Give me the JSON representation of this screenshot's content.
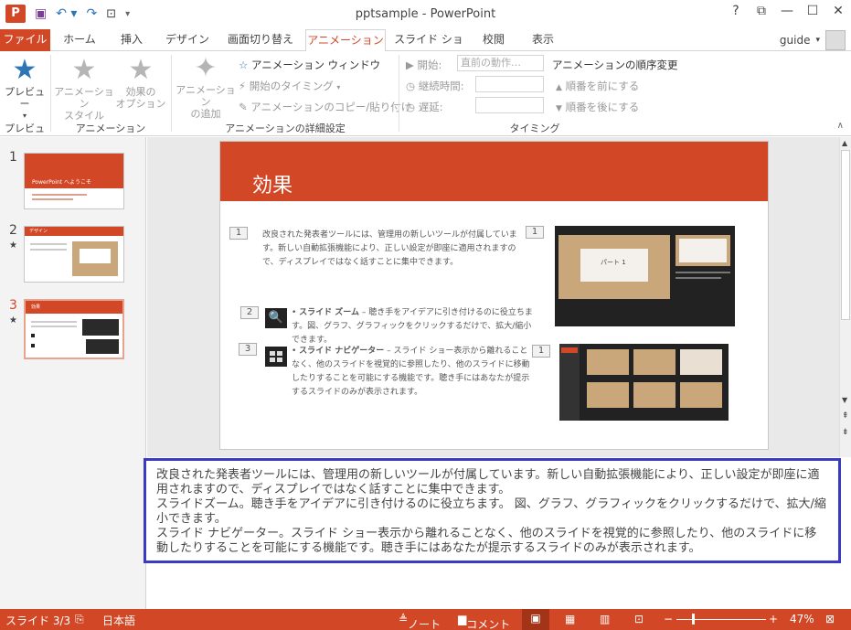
{
  "window": {
    "title": "pptsample - PowerPoint",
    "buttons": [
      "?",
      "⧉",
      "—",
      "☐",
      "✕"
    ]
  },
  "tabs": [
    "ファイル",
    "ホーム",
    "挿入",
    "デザイン",
    "画面切り替え",
    "アニメーション",
    "スライド ショー",
    "校閲",
    "表示"
  ],
  "user": {
    "name": "guide"
  },
  "ribbon": {
    "preview": {
      "label": "プレビュー",
      "group": "プレビュー"
    },
    "animation_style": {
      "label1": "アニメーション",
      "label2": "スタイル"
    },
    "effect_options": {
      "label1": "効果の",
      "label2": "オプション"
    },
    "animation_group": "アニメーション",
    "add_animation": {
      "label1": "アニメーション",
      "label2": "の追加"
    },
    "animation_pane": "アニメーション ウィンドウ",
    "trigger": "開始のタイミング",
    "painter": "アニメーションのコピー/貼り付け",
    "advanced_group": "アニメーションの詳細設定",
    "start_label": "開始:",
    "start_value": "直前の動作…",
    "duration_label": "継続時間:",
    "delay_label": "遅延:",
    "timing_group": "タイミング",
    "reorder_title": "アニメーションの順序変更",
    "move_earlier": "順番を前にする",
    "move_later": "順番を後にする"
  },
  "thumbnails": [
    {
      "num": "1",
      "star": "",
      "title": "PowerPoint へようこそ"
    },
    {
      "num": "2",
      "star": "★",
      "title": "デザイン"
    },
    {
      "num": "3",
      "star": "★",
      "title": "効果"
    }
  ],
  "slide": {
    "title": "効果",
    "para1": "改良された発表者ツールには、管理用の新しいツールが付属しています。新しい自動拡張機能により、正しい設定が即座に適用されますので、ディスプレイではなく話すことに集中できます。",
    "b1_bold": "スライド ズーム",
    "b1_text": " – 聴き手をアイデアに引き付けるのに役立ちます。図、グラフ、グラフィックをクリックするだけで、拡大/縮小できます。",
    "b2_bold": "スライド ナビゲーター",
    "b2_text": " – スライド ショー表示から離れることなく、他のスライドを視覚的に参照したり、他のスライドに移動したりすることを可能にする機能です。聴き手にはあなたが提示するスライドのみが表示されます。",
    "n1": "1",
    "n2": "2",
    "n3": "3",
    "n4": "1",
    "n5": "1",
    "shot_label": "パート 1"
  },
  "notes": {
    "line1": "改良された発表者ツールには、管理用の新しいツールが付属しています。新しい自動拡張機能により、正しい設定が即座に適用されますので、ディスプレイではなく話すことに集中できます。",
    "line2": "スライドズーム。聴き手をアイデアに引き付けるのに役立ちます。 図、グラフ、グラフィックをクリックするだけで、拡大/縮小できます。",
    "line3": "スライド ナビゲーター。スライド ショー表示から離れることなく、他のスライドを視覚的に参照したり、他のスライドに移動したりすることを可能にする機能です。聴き手にはあなたが提示するスライドのみが表示されます。"
  },
  "status": {
    "slide": "スライド 3/3",
    "lang": "日本語",
    "notes": "ノート",
    "comments": "コメント",
    "zoom": "47%"
  },
  "colors": {
    "accent": "#d24726",
    "notes_border": "#3a3ac2"
  }
}
